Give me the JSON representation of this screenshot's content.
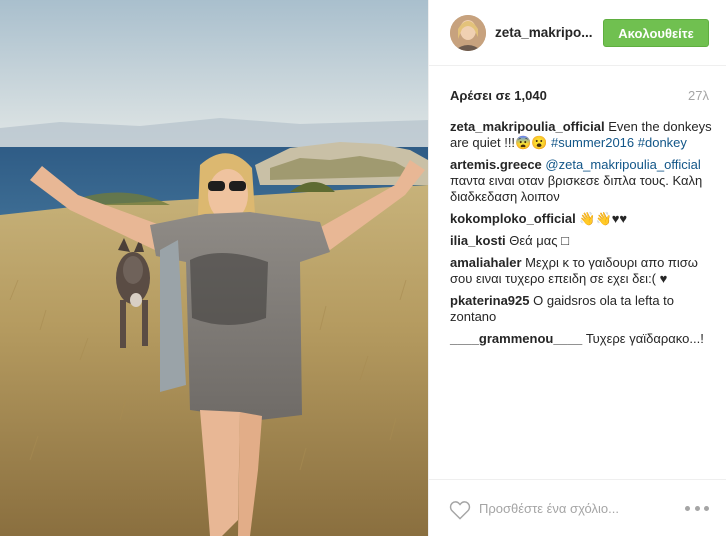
{
  "header": {
    "username": "zeta_makripo...",
    "follow_label": "Ακολουθείτε"
  },
  "stats": {
    "likes_prefix": "Αρέσει σε",
    "likes_count": "1,040",
    "time_ago": "27λ"
  },
  "comments": [
    {
      "user": "zeta_makripoulia_official",
      "text": " Even the donkeys are quiet !!!😨😮 ",
      "tags": [
        "#summer2016",
        "#donkey"
      ]
    },
    {
      "user": "artemis.greece",
      "mention": "@zeta_makripoulia_official",
      "text": " παντα ειναι οταν βρισκεσε διπλα τους. Καλη διαδκεδαση λοιπον"
    },
    {
      "user": "kokomploko_official",
      "text": " 👋👋♥♥"
    },
    {
      "user": "ilia_kosti",
      "text": " Θεά μας □"
    },
    {
      "user": "amaliahaler",
      "text": " Μεχρι κ το γαιδουρι απο πισω σου ειναι τυχερο επειδη σε εχει δει:( ♥"
    },
    {
      "user": "pkaterina925",
      "text": " O gaidsros ola ta lefta to zontano"
    },
    {
      "user": "____grammenou____",
      "text": " Τυχερε γαϊδαρακο...!"
    }
  ],
  "footer": {
    "comment_placeholder": "Προσθέστε ένα σχόλιο...",
    "heart_icon": "heart-outline-icon",
    "more_icon": "more-options-icon"
  },
  "colors": {
    "follow_button": "#70c050",
    "link": "#125688",
    "muted": "#a5a5a5"
  }
}
